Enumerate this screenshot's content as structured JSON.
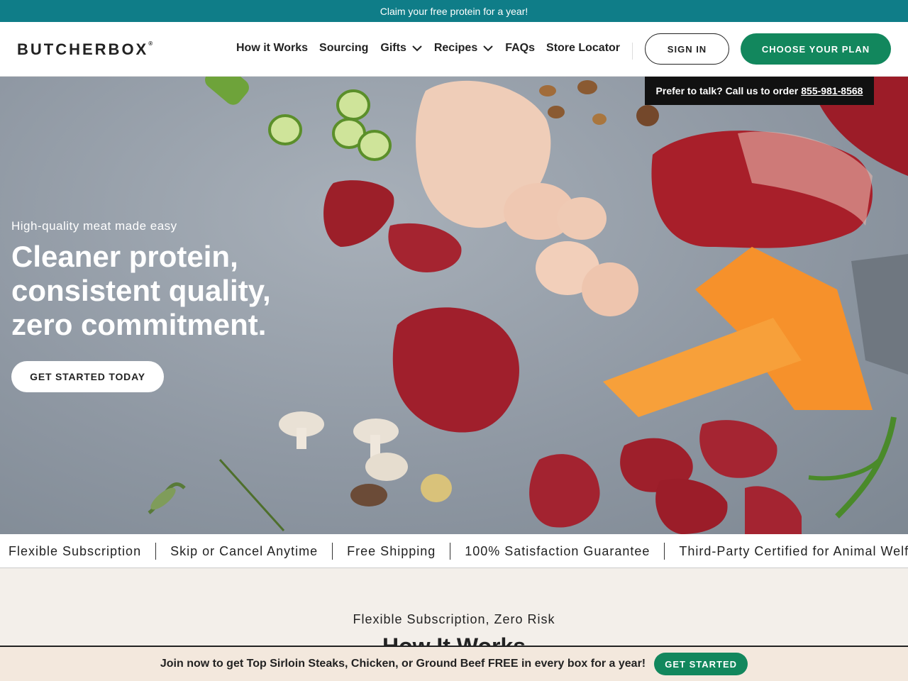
{
  "promo": {
    "text": "Claim your free protein for a year!"
  },
  "header": {
    "logo": "BUTCHERBOX",
    "logo_tm": "®",
    "nav": [
      {
        "label": "How it Works"
      },
      {
        "label": "Sourcing"
      },
      {
        "label": "Gifts",
        "icon": "chevron-down-icon"
      },
      {
        "label": "Recipes",
        "icon": "chevron-down-icon"
      },
      {
        "label": "FAQs"
      },
      {
        "label": "Store Locator"
      }
    ],
    "sign_in": "SIGN IN",
    "choose_plan": "CHOOSE YOUR PLAN"
  },
  "phone": {
    "text": "Prefer to talk? Call us to order",
    "number": "855-981-8568"
  },
  "hero": {
    "eyebrow": "High-quality meat made easy",
    "title_lines": [
      "Cleaner protein,",
      "consistent quality,",
      "zero commitment."
    ],
    "cta": "GET STARTED TODAY"
  },
  "benefits": [
    "Flexible Subscription",
    "Skip or Cancel Anytime",
    "Free Shipping",
    "100% Satisfaction Guarantee",
    "Third-Party Certified for Animal Welfa"
  ],
  "how_it_works": {
    "eyebrow": "Flexible Subscription, Zero Risk",
    "title": "How It Works"
  },
  "sticky": {
    "text": "Join now to get Top Sirloin Steaks, Chicken, or Ground Beef FREE in every box for a year!",
    "cta": "GET STARTED"
  },
  "colors": {
    "teal": "#0f7d88",
    "green": "#12875d",
    "cream": "#f3efea",
    "dark": "#111111"
  }
}
